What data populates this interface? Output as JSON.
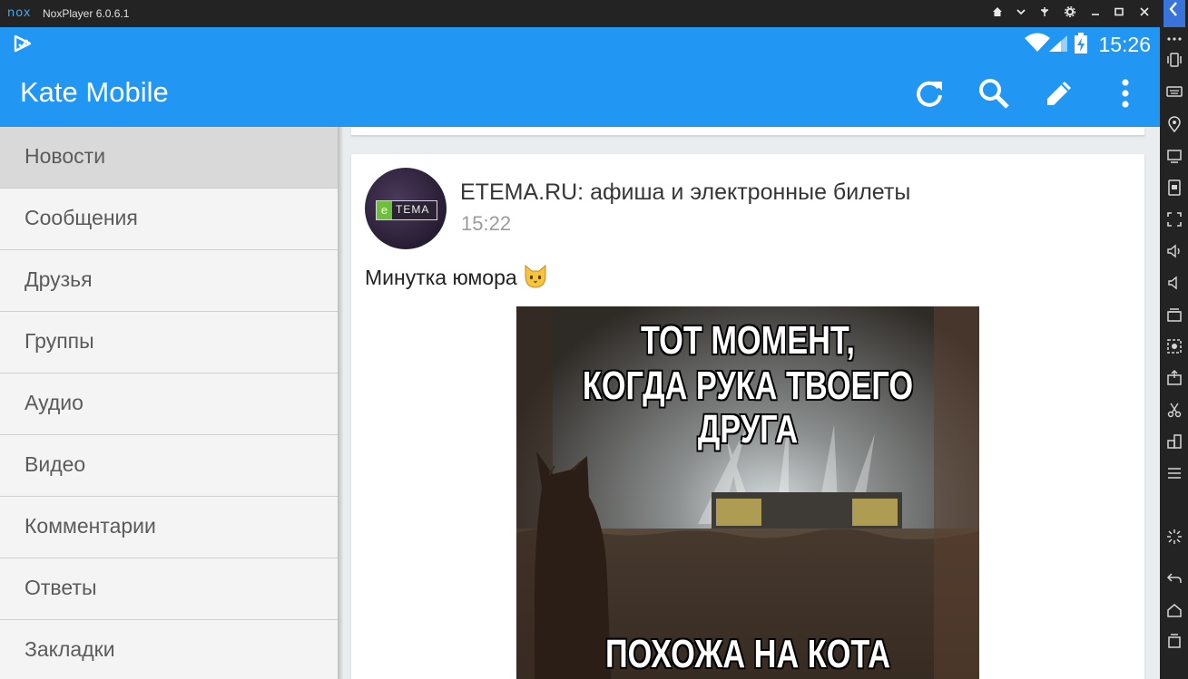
{
  "window": {
    "logo": "nox",
    "title": "NoxPlayer 6.0.6.1",
    "controls": [
      "home-icon",
      "chevron-down-icon",
      "pin-icon",
      "gear-icon",
      "minimize-icon",
      "maximize-icon",
      "close-icon"
    ]
  },
  "status": {
    "time": "15:26",
    "icons": [
      "wifi-icon",
      "signal-icon",
      "battery-charging-icon"
    ]
  },
  "appbar": {
    "title": "Kate Mobile",
    "actions": [
      "refresh-icon",
      "search-icon",
      "edit-icon",
      "more-vert-icon"
    ]
  },
  "drawer": {
    "items": [
      {
        "label": "Новости",
        "active": true
      },
      {
        "label": "Сообщения"
      },
      {
        "label": "Друзья"
      },
      {
        "label": "Группы"
      },
      {
        "label": "Аудио"
      },
      {
        "label": "Видео"
      },
      {
        "label": "Комментарии"
      },
      {
        "label": "Ответы"
      },
      {
        "label": "Закладки"
      }
    ]
  },
  "post": {
    "author": "ETEMA.RU: афиша и электронные билеты",
    "time": "15:22",
    "avatar_text": {
      "e": "e",
      "tema": "ТЕМА"
    },
    "text": "Минутка юмора",
    "meme": {
      "top_line1": "ТОТ МОМЕНТ,",
      "top_line2": "КОГДА РУКА ТВОЕГО ДРУГА",
      "bottom": "ПОХОЖА НА КОТА"
    }
  },
  "colors": {
    "primary": "#2196f3",
    "drawer_active": "#d9d9d9",
    "drawer_text": "#5b5b5b",
    "nox_frame": "#232323"
  }
}
